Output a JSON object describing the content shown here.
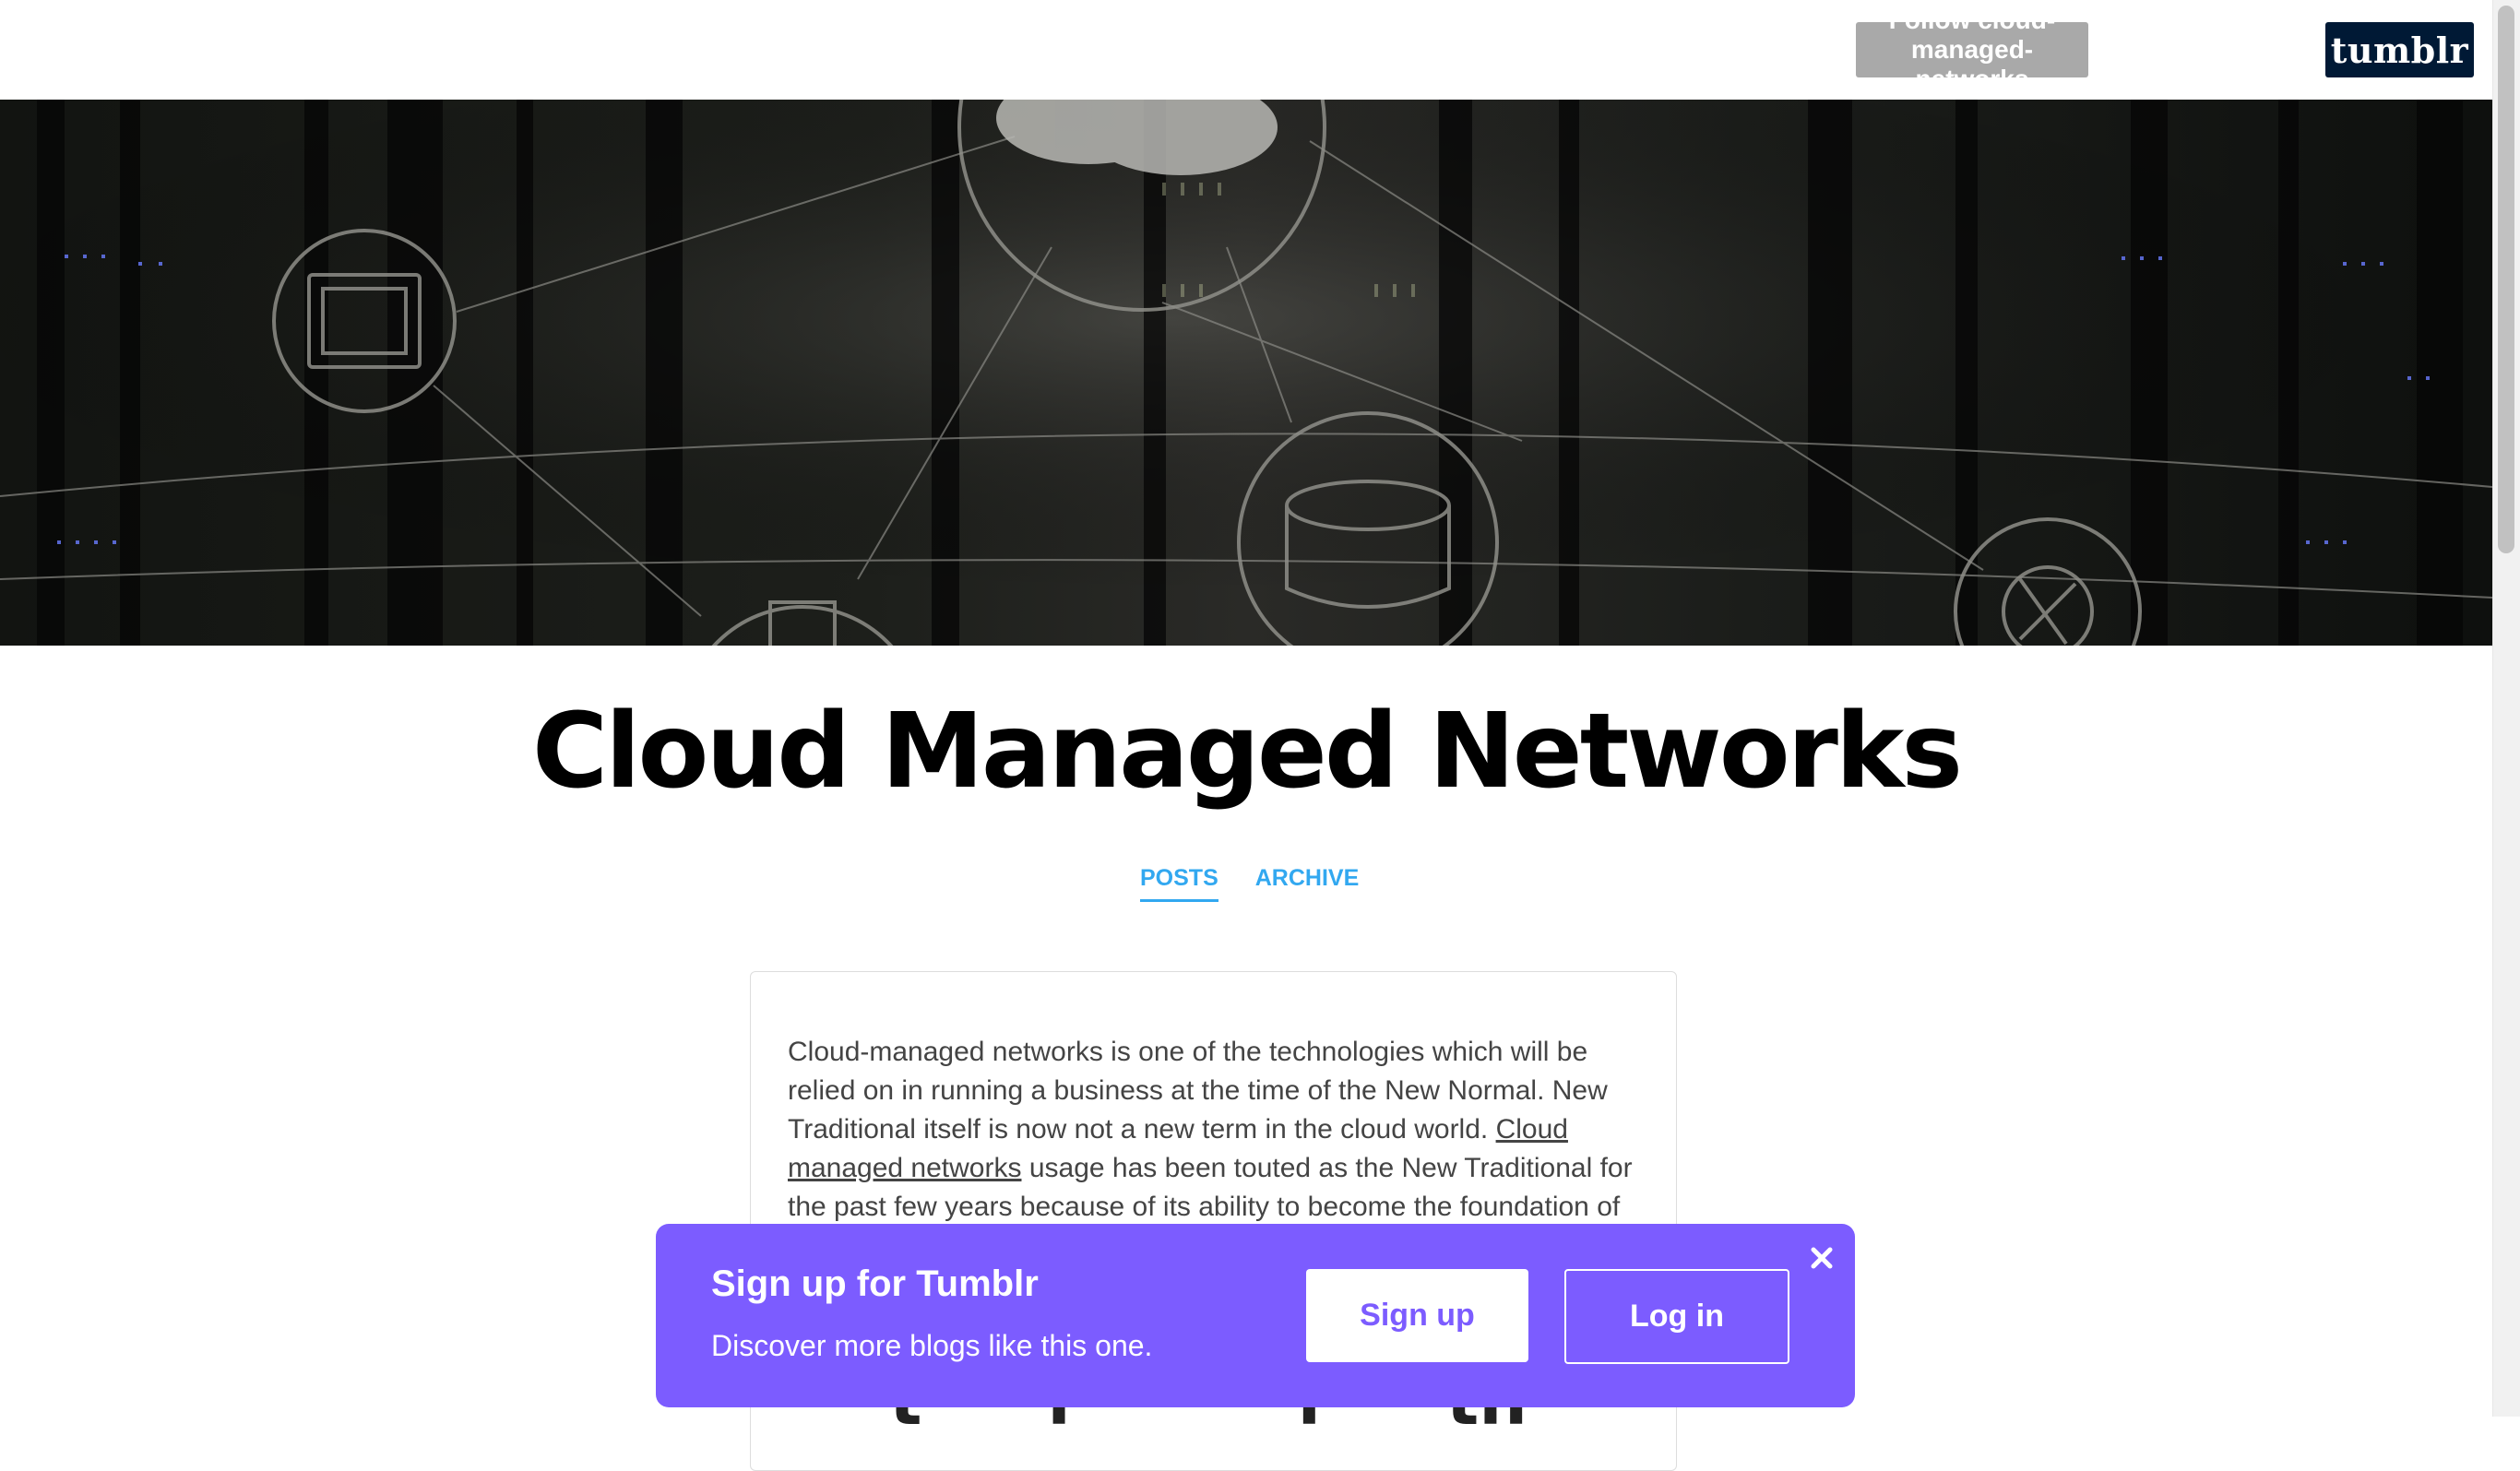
{
  "topbar": {
    "follow_label": "Follow cloud-managed-networks",
    "logo_text": "tumblr"
  },
  "header_image": {
    "alt": ""
  },
  "blog": {
    "title": "Cloud Managed Networks"
  },
  "nav": {
    "items": [
      {
        "label": "POSTS",
        "active": true
      },
      {
        "label": "ARCHIVE",
        "active": false
      }
    ]
  },
  "post": {
    "text_before_link": "Cloud-managed networks is one of the technologies which will be relied on in running a business at the time of the New Normal. New Traditional itself is now not a new term in the cloud world. ",
    "link_text": "Cloud managed networks",
    "text_after_link": " usage has been touted as the New Traditional for the past few years because of its ability to become the foundation of numerous digital services.",
    "heading_partial": "··· t ··· l ··· ··· l ··· th"
  },
  "signup_banner": {
    "title": "Sign up for Tumblr",
    "subtitle": "Discover more blogs like this one.",
    "signup_label": "Sign up",
    "login_label": "Log in",
    "close_icon": "close-icon"
  },
  "colors": {
    "banner_bg": "#7c5cff",
    "nav_accent": "#32a8f0",
    "logo_bg": "#001935",
    "follow_bg": "#a9a9a9"
  }
}
